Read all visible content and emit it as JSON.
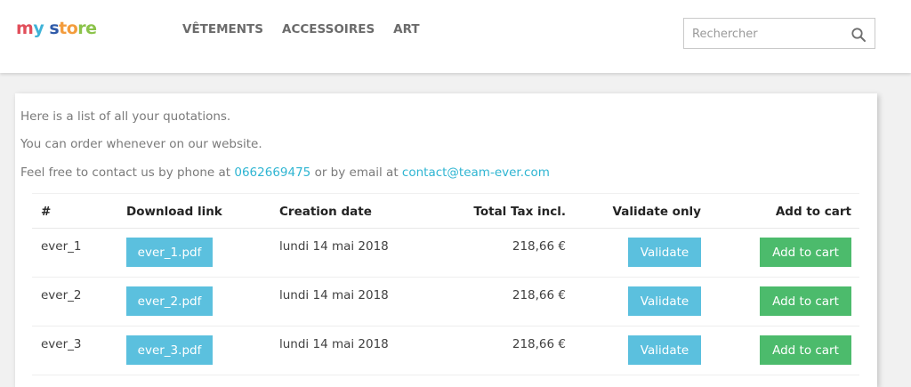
{
  "header": {
    "logo": {
      "part1": "m",
      "part2": "y",
      "part3": " s",
      "part4": "to",
      "part5": "re"
    },
    "nav": [
      "VÊTEMENTS",
      "ACCESSOIRES",
      "ART"
    ],
    "search": {
      "placeholder": "Rechercher",
      "icon": "search-icon"
    }
  },
  "intro": {
    "line1": "Here is a list of all your quotations.",
    "line2": "You can order whenever on our website.",
    "line3_prefix": "Feel free to contact us by phone at ",
    "phone": "0662669475",
    "line3_middle": " or by email at ",
    "email": "contact@team-ever.com"
  },
  "table": {
    "headers": {
      "id": "#",
      "download": "Download link",
      "date": "Creation date",
      "total": "Total Tax incl.",
      "validate": "Validate only",
      "cart": "Add to cart"
    },
    "rows": [
      {
        "id": "ever_1",
        "file": "ever_1.pdf",
        "date": "lundi 14 mai 2018",
        "total": "218,66 €",
        "validate": "Validate",
        "cart": "Add to cart"
      },
      {
        "id": "ever_2",
        "file": "ever_2.pdf",
        "date": "lundi 14 mai 2018",
        "total": "218,66 €",
        "validate": "Validate",
        "cart": "Add to cart"
      },
      {
        "id": "ever_3",
        "file": "ever_3.pdf",
        "date": "lundi 14 mai 2018",
        "total": "218,66 €",
        "validate": "Validate",
        "cart": "Add to cart"
      }
    ]
  },
  "colors": {
    "accent": "#2fb5d2",
    "info_button": "#5bc0de",
    "success_button": "#4cbb6c"
  }
}
